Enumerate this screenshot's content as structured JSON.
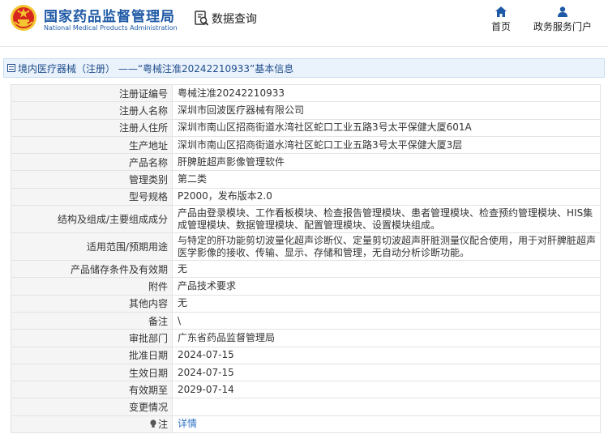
{
  "header": {
    "brand_cn": "国家药品监督管理局",
    "brand_en": "National Medical Products Administration",
    "query_label": "数据查询",
    "nav": {
      "home": "首页",
      "gov": "政务服务门户"
    },
    "colors": {
      "brand": "#1f5aa6",
      "emblem_red": "#d7261e",
      "emblem_gold": "#f3c530"
    }
  },
  "titlebar": {
    "text": "境内医疗器械（注册） ——“粤械注准20242210933”基本信息"
  },
  "rows": [
    {
      "label": "注册证编号",
      "value": "粤械注准20242210933"
    },
    {
      "label": "注册人名称",
      "value": "深圳市回波医疗器械有限公司"
    },
    {
      "label": "注册人住所",
      "value": "深圳市南山区招商街道水湾社区蛇口工业五路3号太平保健大厦601A"
    },
    {
      "label": "生产地址",
      "value": "深圳市南山区招商街道水湾社区蛇口工业五路3号太平保健大厦3层"
    },
    {
      "label": "产品名称",
      "value": "肝脾脏超声影像管理软件"
    },
    {
      "label": "管理类别",
      "value": "第二类"
    },
    {
      "label": "型号规格",
      "value": "P2000，发布版本2.0"
    },
    {
      "label": "结构及组成/主要组成成分",
      "value": "产品由登录模块、工作看板模块、检查报告管理模块、患者管理模块、检查预约管理模块、HIS集成管理模块、数据管理模块、配置管理模块、设置模块组成。"
    },
    {
      "label": "适用范围/预期用途",
      "value": "与特定的肝功能剪切波量化超声诊断仪、定量剪切波超声肝脏测量仪配合使用，用于对肝脾脏超声医学影像的接收、传输、显示、存储和管理，无自动分析诊断功能。"
    },
    {
      "label": "产品储存条件及有效期",
      "value": "无"
    },
    {
      "label": "附件",
      "value": "产品技术要求"
    },
    {
      "label": "其他内容",
      "value": "无"
    },
    {
      "label": "备注",
      "value": "\\"
    },
    {
      "label": "审批部门",
      "value": "广东省药品监督管理局"
    },
    {
      "label": "批准日期",
      "value": "2024-07-15"
    },
    {
      "label": "生效日期",
      "value": "2024-07-15"
    },
    {
      "label": "有效期至",
      "value": "2029-07-14"
    },
    {
      "label": "变更情况",
      "value": ""
    }
  ],
  "note_row": {
    "label": "注",
    "link": "详情"
  }
}
